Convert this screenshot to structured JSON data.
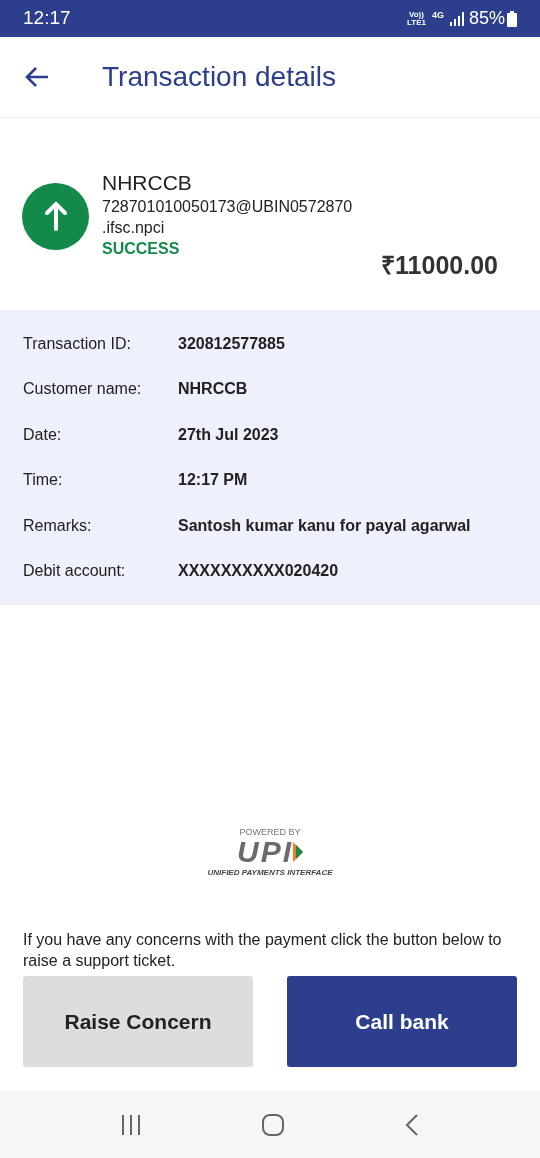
{
  "status_bar": {
    "time": "12:17",
    "volte": "Vo))",
    "lte": "LTE1",
    "network": "4G",
    "battery": "85%"
  },
  "header": {
    "title": "Transaction details"
  },
  "transaction": {
    "payee": "NHRCCB",
    "upi_id": "728701010050173@UBIN0572870",
    "upi_id_rest": ".ifsc.npci",
    "status": "SUCCESS",
    "amount": "₹11000.00"
  },
  "details": [
    {
      "label": "Transaction ID:",
      "value": "320812577885"
    },
    {
      "label": "Customer name:",
      "value": "NHRCCB"
    },
    {
      "label": "Date:",
      "value": "27th Jul 2023"
    },
    {
      "label": "Time:",
      "value": "12:17 PM"
    },
    {
      "label": "Remarks:",
      "value": "Santosh kumar kanu for payal agarwal"
    },
    {
      "label": "Debit account:",
      "value": "XXXXXXXXXX020420"
    }
  ],
  "upi_logo": {
    "top": "POWERED BY",
    "mark": "UPI",
    "bottom": "UNIFIED PAYMENTS INTERFACE"
  },
  "concern_text": "If you have any concerns with the payment click the button below to raise a support ticket.",
  "buttons": [
    {
      "label": "Raise Concern",
      "kind": "secondary"
    },
    {
      "label": "Call bank",
      "kind": "primary"
    }
  ]
}
